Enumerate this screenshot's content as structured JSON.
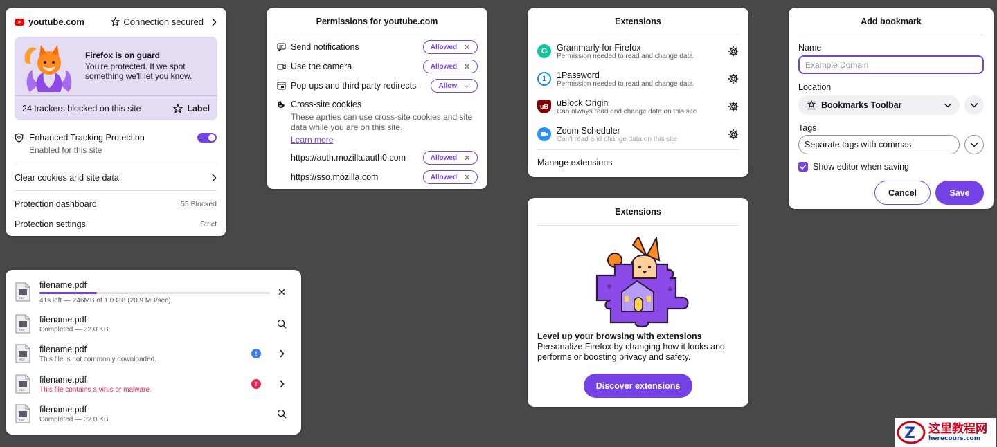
{
  "colors": {
    "accent": "#7542e5",
    "error": "#e22850",
    "info": "#3f7de8",
    "background": "#48484b"
  },
  "site_panel": {
    "domain": "youtube.com",
    "connection": "Connection secured",
    "guard_title": "Firefox is on guard",
    "guard_text": "You're protected. If we spot something we'll let you know.",
    "trackers": "24 trackers blocked on this site",
    "label_button": "Label",
    "etp_title": "Enhanced Tracking Protection",
    "etp_sub": "Enabled for this site",
    "etp_enabled": true,
    "clear_cookies": "Clear cookies and site data",
    "dashboard": "Protection dashboard",
    "dashboard_value": "55 Blocked",
    "settings": "Protection settings",
    "settings_value": "Strict"
  },
  "permissions_panel": {
    "title": "Permissions for youtube.com",
    "items": [
      {
        "label": "Send notifications",
        "state": "Allowed",
        "icon": "notification-icon"
      },
      {
        "label": "Use the camera",
        "state": "Allowed",
        "icon": "camera-icon"
      },
      {
        "label": "Pop-ups and third party redirects",
        "state": "Allow",
        "icon": "popup-icon"
      }
    ],
    "cookies_title": "Cross-site cookies",
    "cookies_desc": "These aprties can use cross-site cookies and site data while you are on this site.",
    "learn_more": "Learn more",
    "sites": [
      {
        "label": "https://auth.mozilla.auth0.com",
        "state": "Allowed"
      },
      {
        "label": "https://sso.mozilla.com",
        "state": "Allowed"
      }
    ]
  },
  "extensions_panel": {
    "title": "Extensions",
    "items": [
      {
        "name": "Grammarly for Firefox",
        "desc": "Permission needed to read and change data",
        "icon": "grammarly-icon",
        "color": "#15c39a"
      },
      {
        "name": "1Password",
        "desc": "Permission needed to read and change data",
        "icon": "onepassword-icon",
        "color": "#1a8cff"
      },
      {
        "name": "uBlock Origin",
        "desc": "Can always read and change data on this site",
        "icon": "ublock-icon",
        "color": "#800000"
      },
      {
        "name": "Zoom Scheduler",
        "desc": "Can't read and change data on this site",
        "icon": "zoom-icon",
        "color": "#2d8cff"
      }
    ],
    "manage": "Manage extensions"
  },
  "extensions_empty_panel": {
    "title": "Extensions",
    "heading": "Level up your browsing with extensions",
    "text": "Personalize Firefox by changing how it looks and performs or boosting privacy and safety.",
    "button": "Discover extensions"
  },
  "bookmark_panel": {
    "title": "Add bookmark",
    "name_label": "Name",
    "name_placeholder": "Example Domain",
    "location_label": "Location",
    "location_value": "Bookmarks Toolbar",
    "tags_label": "Tags",
    "tags_placeholder": "Separate tags with commas",
    "show_editor": "Show editor when saving",
    "show_editor_checked": true,
    "cancel": "Cancel",
    "save": "Save"
  },
  "downloads_panel": {
    "items": [
      {
        "name": "filename.pdf",
        "status": "41s left — 246MB of 1.0 GB (20.9 MB/sec)",
        "progress": 0.25,
        "action": "close-icon"
      },
      {
        "name": "filename.pdf",
        "status": "Completed — 32.0 KB",
        "action": "search-icon"
      },
      {
        "name": "filename.pdf",
        "status": "This file is not commonly downloaded.",
        "badge": "info",
        "action": "chevron-right-icon"
      },
      {
        "name": "filename.pdf",
        "status": "This file contains a virus or malware.",
        "badge": "error",
        "action": "chevron-right-icon"
      },
      {
        "name": "filename.pdf",
        "status": "Completed — 32.0 KB",
        "action": "search-icon"
      }
    ]
  },
  "watermark": {
    "cn": "这里教程网",
    "url": "herecours.com"
  }
}
